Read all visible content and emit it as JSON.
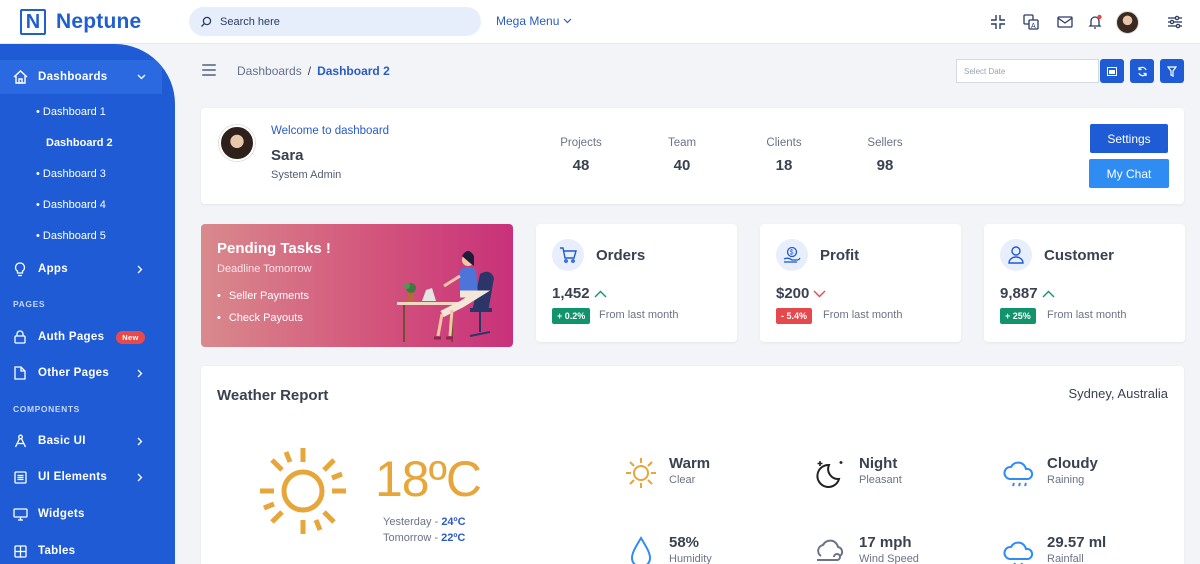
{
  "brand": {
    "name": "Neptune",
    "logo_letter": "N"
  },
  "search": {
    "placeholder": "Search here"
  },
  "mega_menu": {
    "label": "Mega Menu"
  },
  "sidebar": {
    "dashboards": "Dashboards",
    "sub_items": [
      "Dashboard 1",
      "Dashboard 2",
      "Dashboard 3",
      "Dashboard 4",
      "Dashboard 5"
    ],
    "apps": "Apps",
    "section_pages": "PAGES",
    "auth_pages": "Auth Pages",
    "auth_badge": "New",
    "other_pages": "Other Pages",
    "section_components": "COMPONENTS",
    "basic_ui": "Basic UI",
    "ui_elements": "UI Elements",
    "widgets": "Widgets",
    "tables": "Tables"
  },
  "breadcrumb": {
    "parent": "Dashboards",
    "separator": "/",
    "current": "Dashboard 2"
  },
  "date_filter": {
    "placeholder": "Select Date"
  },
  "welcome": {
    "greeting": "Welcome to dashboard",
    "name": "Sara",
    "role": "System Admin",
    "stats": [
      {
        "label": "Projects",
        "value": "48"
      },
      {
        "label": "Team",
        "value": "40"
      },
      {
        "label": "Clients",
        "value": "18"
      },
      {
        "label": "Sellers",
        "value": "98"
      }
    ],
    "settings_label": "Settings",
    "chat_label": "My Chat"
  },
  "pending": {
    "title": "Pending Tasks !",
    "subtitle": "Deadline Tomorrow",
    "items": [
      "Seller Payments",
      "Check Payouts"
    ]
  },
  "metrics": [
    {
      "title": "Orders",
      "value": "1,452",
      "trend": "up",
      "badge": "+ 0.2%",
      "badge_color": "#11946b",
      "note": "From last month"
    },
    {
      "title": "Profit",
      "value": "$200",
      "trend": "down",
      "badge": "- 5.4%",
      "badge_color": "#e5484d",
      "note": "From last month"
    },
    {
      "title": "Customer",
      "value": "9,887",
      "trend": "up",
      "badge": "+ 25%",
      "badge_color": "#11946b",
      "note": "From last month"
    }
  ],
  "weather": {
    "title": "Weather Report",
    "location": "Sydney, Australia",
    "temp": "18ºC",
    "yesterday_label": "Yesterday -",
    "yesterday_value": "24ºC",
    "tomorrow_label": "Tomorrow -",
    "tomorrow_value": "22ºC",
    "conditions": [
      {
        "name": "Warm",
        "desc": "Clear"
      },
      {
        "name": "Night",
        "desc": "Pleasant"
      },
      {
        "name": "Cloudy",
        "desc": "Raining"
      },
      {
        "name": "58%",
        "desc": "Humidity"
      },
      {
        "name": "17 mph",
        "desc": "Wind Speed"
      },
      {
        "name": "29.57 ml",
        "desc": "Rainfall"
      }
    ]
  },
  "colors": {
    "primary": "#1e5bd4",
    "accent": "#2f8cf2",
    "sun": "#e6a63a",
    "up": "#11946b",
    "down": "#e5484d"
  }
}
